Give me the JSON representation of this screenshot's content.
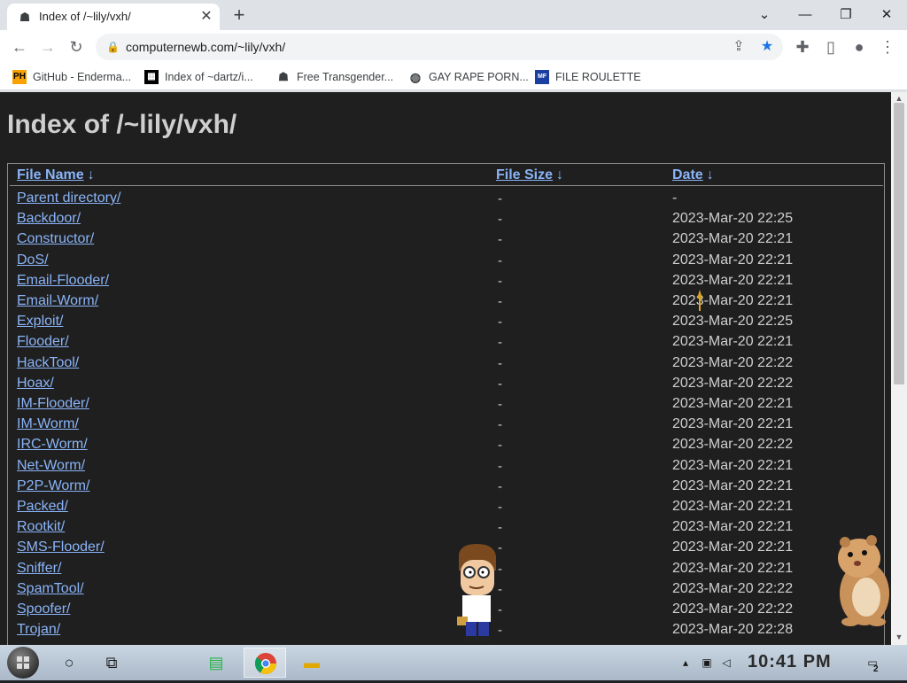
{
  "tab": {
    "title": "Index of /~lily/vxh/"
  },
  "address": {
    "url": "computernewb.com/~lily/vxh/"
  },
  "bookmarks": [
    {
      "icon_text": "PH",
      "label": "GitHub - Enderma..."
    },
    {
      "icon_text": "",
      "label": "Index of ~dartz/i..."
    },
    {
      "icon_text": "",
      "label": "Free Transgender..."
    },
    {
      "icon_text": "",
      "label": "GAY RAPE PORN..."
    },
    {
      "icon_text": "MF",
      "label": "FILE ROULETTE"
    }
  ],
  "page": {
    "heading": "Index of /~lily/vxh/",
    "columns": {
      "name": "File Name",
      "size": "File Size",
      "date": "Date",
      "sort_arrow": "↓"
    },
    "rows": [
      {
        "name": "Parent directory/",
        "size": "-",
        "date": "-"
      },
      {
        "name": "Backdoor/",
        "size": "-",
        "date": "2023-Mar-20 22:25"
      },
      {
        "name": "Constructor/",
        "size": "-",
        "date": "2023-Mar-20 22:21"
      },
      {
        "name": "DoS/",
        "size": "-",
        "date": "2023-Mar-20 22:21"
      },
      {
        "name": "Email-Flooder/",
        "size": "-",
        "date": "2023-Mar-20 22:21"
      },
      {
        "name": "Email-Worm/",
        "size": "-",
        "date": "2023-Mar-20 22:21"
      },
      {
        "name": "Exploit/",
        "size": "-",
        "date": "2023-Mar-20 22:25"
      },
      {
        "name": "Flooder/",
        "size": "-",
        "date": "2023-Mar-20 22:21"
      },
      {
        "name": "HackTool/",
        "size": "-",
        "date": "2023-Mar-20 22:22"
      },
      {
        "name": "Hoax/",
        "size": "-",
        "date": "2023-Mar-20 22:22"
      },
      {
        "name": "IM-Flooder/",
        "size": "-",
        "date": "2023-Mar-20 22:21"
      },
      {
        "name": "IM-Worm/",
        "size": "-",
        "date": "2023-Mar-20 22:21"
      },
      {
        "name": "IRC-Worm/",
        "size": "-",
        "date": "2023-Mar-20 22:22"
      },
      {
        "name": "Net-Worm/",
        "size": "-",
        "date": "2023-Mar-20 22:21"
      },
      {
        "name": "P2P-Worm/",
        "size": "-",
        "date": "2023-Mar-20 22:21"
      },
      {
        "name": "Packed/",
        "size": "-",
        "date": "2023-Mar-20 22:21"
      },
      {
        "name": "Rootkit/",
        "size": "-",
        "date": "2023-Mar-20 22:21"
      },
      {
        "name": "SMS-Flooder/",
        "size": "-",
        "date": "2023-Mar-20 22:21"
      },
      {
        "name": "Sniffer/",
        "size": "-",
        "date": "2023-Mar-20 22:21"
      },
      {
        "name": "SpamTool/",
        "size": "-",
        "date": "2023-Mar-20 22:22"
      },
      {
        "name": "Spoofer/",
        "size": "-",
        "date": "2023-Mar-20 22:22"
      },
      {
        "name": "Trojan/",
        "size": "-",
        "date": "2023-Mar-20 22:28"
      }
    ]
  },
  "taskbar": {
    "clock": "10:41 PM",
    "notification_count": "2"
  },
  "colors": {
    "link": "#8ab4f8",
    "page_bg": "#1f1f1f",
    "text": "#cfcfcf",
    "star": "#1a73e8"
  }
}
